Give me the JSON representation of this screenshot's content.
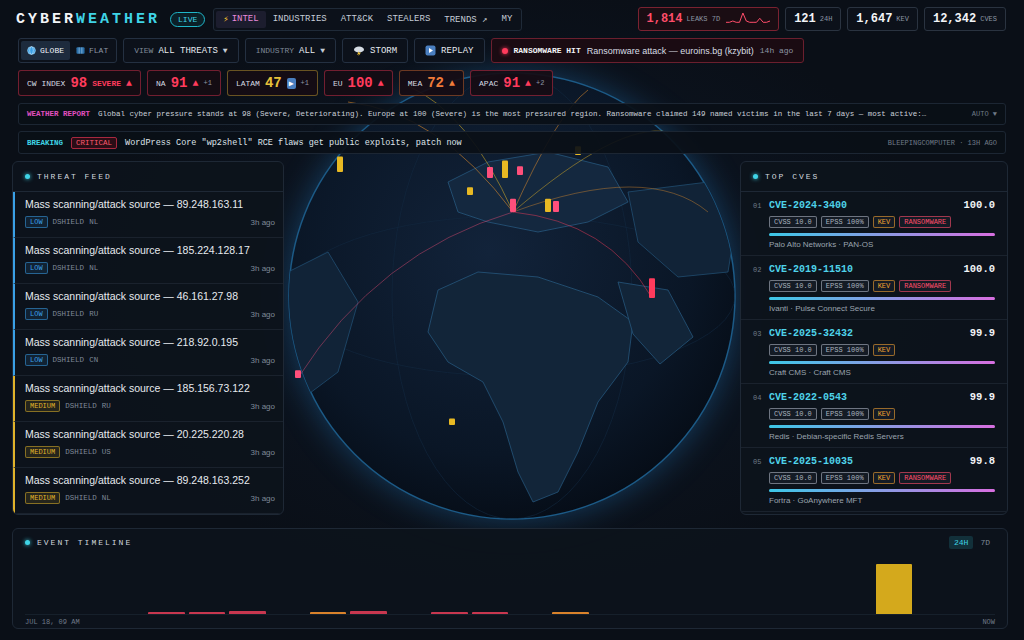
{
  "header": {
    "logo": {
      "first": "CYBER",
      "second": "WEATHER"
    },
    "live": "LIVE",
    "nav": [
      {
        "icon": "⚡",
        "label": "INTEL",
        "selected": true
      },
      {
        "icon": "",
        "label": "INDUSTRIES",
        "selected": false
      },
      {
        "icon": "",
        "label": "ATT&CK",
        "selected": false
      },
      {
        "icon": "",
        "label": "STEALERS",
        "selected": false
      },
      {
        "icon": "",
        "label": "TRENDS ↗",
        "selected": false
      },
      {
        "icon": "",
        "label": "MY",
        "selected": false
      }
    ],
    "stats": [
      {
        "value": "1,814",
        "label": "LEAKS 7D",
        "alert": true,
        "sparkline": [
          2,
          2,
          3,
          2,
          2,
          9,
          3,
          2,
          2,
          2,
          5,
          2,
          2,
          3
        ]
      },
      {
        "value": "121",
        "label": "24H",
        "alert": false,
        "sparkline": []
      },
      {
        "value": "1,647",
        "label": "KEV",
        "alert": false,
        "sparkline": []
      },
      {
        "value": "12,342",
        "label": "CVES",
        "alert": false,
        "sparkline": []
      }
    ]
  },
  "controls": {
    "view_toggle": [
      {
        "label": "GLOBE",
        "kind": "globe",
        "selected": true
      },
      {
        "label": "FLAT",
        "kind": "flat",
        "selected": false
      }
    ],
    "dropdowns": [
      {
        "label": "VIEW",
        "value": "ALL THREATS",
        "caret": "▼"
      },
      {
        "label": "INDUSTRY",
        "value": "ALL",
        "caret": "▼"
      }
    ],
    "buttons": [
      {
        "label": "STORM",
        "kind": "storm"
      },
      {
        "label": "REPLAY",
        "kind": "replay"
      }
    ],
    "ticker": {
      "label": "RANSOMWARE HIT",
      "text": "Ransomware attack — euroins.bg (kzybit)",
      "time": "14h ago"
    }
  },
  "regions": [
    {
      "label": "CW INDEX",
      "value": "98",
      "status": "SEVERE",
      "trend": "▲",
      "kind": "up",
      "delta": "",
      "color": "#ff3b5c"
    },
    {
      "label": "NA",
      "value": "91",
      "status": "",
      "trend": "▲",
      "kind": "up",
      "delta": "+1",
      "color": "#ff3b5c"
    },
    {
      "label": "LATAM",
      "value": "47",
      "status": "",
      "trend": "▶",
      "kind": "steady",
      "delta": "+1",
      "color": "#e8c13a"
    },
    {
      "label": "EU",
      "value": "100",
      "status": "",
      "trend": "▲",
      "kind": "up",
      "delta": "",
      "color": "#ff3b5c"
    },
    {
      "label": "MEA",
      "value": "72",
      "status": "",
      "trend": "▲",
      "kind": "up",
      "delta": "",
      "color": "#f07c3a"
    },
    {
      "label": "APAC",
      "value": "91",
      "status": "",
      "trend": "▲",
      "kind": "up",
      "delta": "+2",
      "color": "#ff3b5c"
    }
  ],
  "weather_report": {
    "label": "WEATHER REPORT",
    "text": "Global cyber pressure stands at 98 (Severe, Deteriorating). Europe at 100 (Severe) is the most pressured region. Ransomware claimed 149 named victims in the last 7 days — most active:…",
    "control": "AUTO ▼"
  },
  "breaking": {
    "label": "BREAKING",
    "severity": "CRITICAL",
    "text": "WordPress Core \"wp2shell\" RCE flaws get public exploits, patch now",
    "source": "BLEEPINGCOMPUTER · 13H AGO"
  },
  "globe": {
    "markers": [
      {
        "color": "#e8b923",
        "level": 0.7
      },
      {
        "color": "#ff4f7b",
        "level": 0.5
      },
      {
        "color": "#e8b923",
        "level": 0.8
      },
      {
        "color": "#ff4f7b",
        "level": 0.4
      },
      {
        "color": "#ff4f7b",
        "level": 0.6
      },
      {
        "color": "#e8b923",
        "level": 0.6
      },
      {
        "color": "#ff4f7b",
        "level": 0.5
      },
      {
        "color": "#e8b923",
        "level": 0.4
      },
      {
        "color": "#ff3b5c",
        "level": 0.9
      },
      {
        "color": "#ff4f7b",
        "level": 0.35
      },
      {
        "color": "#e8b923",
        "level": 0.3
      },
      {
        "color": "#e8b923",
        "level": 0.35
      }
    ]
  },
  "threat_feed": {
    "title": "THREAT FEED",
    "items": [
      {
        "title": "Mass scanning/attack source — 89.248.163.11",
        "severity": "LOW",
        "source": "DSHIELD",
        "country": "NL",
        "time": "3h ago",
        "color": "#3aa0e6"
      },
      {
        "title": "Mass scanning/attack source — 185.224.128.17",
        "severity": "LOW",
        "source": "DSHIELD",
        "country": "NL",
        "time": "3h ago",
        "color": "#3aa0e6"
      },
      {
        "title": "Mass scanning/attack source — 46.161.27.98",
        "severity": "LOW",
        "source": "DSHIELD",
        "country": "RU",
        "time": "3h ago",
        "color": "#3aa0e6"
      },
      {
        "title": "Mass scanning/attack source — 218.92.0.195",
        "severity": "LOW",
        "source": "DSHIELD",
        "country": "CN",
        "time": "3h ago",
        "color": "#3aa0e6"
      },
      {
        "title": "Mass scanning/attack source — 185.156.73.122",
        "severity": "MEDIUM",
        "source": "DSHIELD",
        "country": "RU",
        "time": "3h ago",
        "color": "#e0b22a"
      },
      {
        "title": "Mass scanning/attack source — 20.225.220.28",
        "severity": "MEDIUM",
        "source": "DSHIELD",
        "country": "US",
        "time": "3h ago",
        "color": "#e0b22a"
      },
      {
        "title": "Mass scanning/attack source — 89.248.163.252",
        "severity": "MEDIUM",
        "source": "DSHIELD",
        "country": "NL",
        "time": "3h ago",
        "color": "#e0b22a"
      }
    ]
  },
  "top_cves": {
    "title": "TOP CVES",
    "items": [
      {
        "rank": "01",
        "id": "CVE-2024-3400",
        "score": "100.0",
        "tags": [
          {
            "label": "CVSS 10.0",
            "color": "#aab3bf"
          },
          {
            "label": "EPSS 100%",
            "color": "#aab3bf"
          },
          {
            "label": "KEV",
            "color": "#f0a030"
          },
          {
            "label": "RANSOMWARE",
            "color": "#ff4d6a"
          }
        ],
        "level": 1.0,
        "vendor": "Palo Alto Networks · PAN-OS"
      },
      {
        "rank": "02",
        "id": "CVE-2019-11510",
        "score": "100.0",
        "tags": [
          {
            "label": "CVSS 10.0",
            "color": "#aab3bf"
          },
          {
            "label": "EPSS 100%",
            "color": "#aab3bf"
          },
          {
            "label": "KEV",
            "color": "#f0a030"
          },
          {
            "label": "RANSOMWARE",
            "color": "#ff4d6a"
          }
        ],
        "level": 1.0,
        "vendor": "Ivanti · Pulse Connect Secure"
      },
      {
        "rank": "03",
        "id": "CVE-2025-32432",
        "score": "99.9",
        "tags": [
          {
            "label": "CVSS 10.0",
            "color": "#aab3bf"
          },
          {
            "label": "EPSS 100%",
            "color": "#aab3bf"
          },
          {
            "label": "KEV",
            "color": "#f0a030"
          }
        ],
        "level": 0.999,
        "vendor": "Craft CMS · Craft CMS"
      },
      {
        "rank": "04",
        "id": "CVE-2022-0543",
        "score": "99.9",
        "tags": [
          {
            "label": "CVSS 10.0",
            "color": "#aab3bf"
          },
          {
            "label": "EPSS 100%",
            "color": "#aab3bf"
          },
          {
            "label": "KEV",
            "color": "#f0a030"
          }
        ],
        "level": 0.999,
        "vendor": "Redis · Debian-specific Redis Servers"
      },
      {
        "rank": "05",
        "id": "CVE-2025-10035",
        "score": "99.8",
        "tags": [
          {
            "label": "CVSS 10.0",
            "color": "#aab3bf"
          },
          {
            "label": "EPSS 100%",
            "color": "#aab3bf"
          },
          {
            "label": "KEV",
            "color": "#f0a030"
          },
          {
            "label": "RANSOMWARE",
            "color": "#ff4d6a"
          }
        ],
        "level": 0.998,
        "vendor": "Fortra · GoAnywhere MFT"
      }
    ]
  },
  "timeline": {
    "title": "EVENT TIMELINE",
    "ranges": [
      {
        "label": "24H",
        "selected": true
      },
      {
        "label": "7D",
        "selected": false
      }
    ],
    "start": "JUL 18, 09 AM",
    "end": "NOW",
    "bars": [
      {
        "value": 0,
        "color": "#c8374f"
      },
      {
        "value": 0,
        "color": "#c8374f"
      },
      {
        "value": 0,
        "color": "#c8374f"
      },
      {
        "value": 2,
        "color": "#c8374f"
      },
      {
        "value": 2,
        "color": "#c8374f"
      },
      {
        "value": 4,
        "color": "#c8374f"
      },
      {
        "value": 0,
        "color": "#c8374f"
      },
      {
        "value": 3,
        "color": "#d9822b"
      },
      {
        "value": 4,
        "color": "#c8374f"
      },
      {
        "value": 0,
        "color": "#c8374f"
      },
      {
        "value": 2,
        "color": "#c8374f"
      },
      {
        "value": 2,
        "color": "#c8374f"
      },
      {
        "value": 0,
        "color": "#c8374f"
      },
      {
        "value": 2,
        "color": "#d9822b"
      },
      {
        "value": 0,
        "color": "#c8374f"
      },
      {
        "value": 0,
        "color": "#c8374f"
      },
      {
        "value": 0,
        "color": "#c8374f"
      },
      {
        "value": 0,
        "color": "#c8374f"
      },
      {
        "value": 0,
        "color": "#c8374f"
      },
      {
        "value": 0,
        "color": "#c8374f"
      },
      {
        "value": 0,
        "color": "#c8374f"
      },
      {
        "value": 60,
        "color": "#d4a91c"
      },
      {
        "value": 0,
        "color": "#c8374f"
      },
      {
        "value": 0,
        "color": "#c8374f"
      }
    ]
  }
}
